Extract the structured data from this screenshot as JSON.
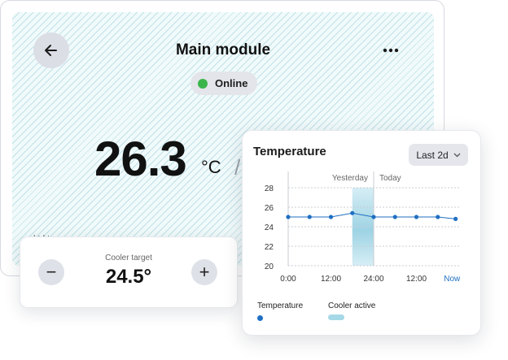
{
  "module": {
    "title": "Main module",
    "more_icon": "more-horizontal-icon",
    "back_icon": "arrow-left-icon",
    "status": {
      "label": "Online",
      "color": "#3bb54a"
    },
    "temperature": "26.3",
    "unit": "°C",
    "partial_text": "l  t  l t"
  },
  "cooler": {
    "label": "Cooler target",
    "value": "24.5°",
    "minus_label": "−",
    "plus_label": "+"
  },
  "temp_card": {
    "title": "Temperature",
    "range_label": "Last 2d",
    "legend_temperature": "Temperature",
    "legend_cooler": "Cooler active"
  },
  "chart_data": {
    "type": "line",
    "title": "Temperature",
    "y_ticks": [
      "28",
      "26",
      "24",
      "22",
      "20"
    ],
    "ylim": [
      20,
      28
    ],
    "x_tick_labels": [
      "0:00",
      "12:00",
      "24:00",
      "12:00",
      "Now"
    ],
    "x_ticks": [
      0,
      12,
      24,
      36,
      46
    ],
    "xlim": [
      0,
      48
    ],
    "period_labels": [
      "Yesterday",
      "Today"
    ],
    "day_boundary": 24,
    "series": [
      {
        "name": "Temperature",
        "color": "#1f6fc2",
        "x": [
          0,
          6,
          12,
          18,
          24,
          30,
          36,
          42,
          47
        ],
        "y": [
          25.0,
          25.0,
          25.0,
          25.4,
          25.0,
          25.0,
          25.0,
          25.0,
          24.8
        ]
      }
    ],
    "cooler_active": {
      "name": "Cooler active",
      "start": 18,
      "end": 24,
      "color": "#a5d8e6"
    },
    "grid": true,
    "legend_position": "bottom"
  }
}
